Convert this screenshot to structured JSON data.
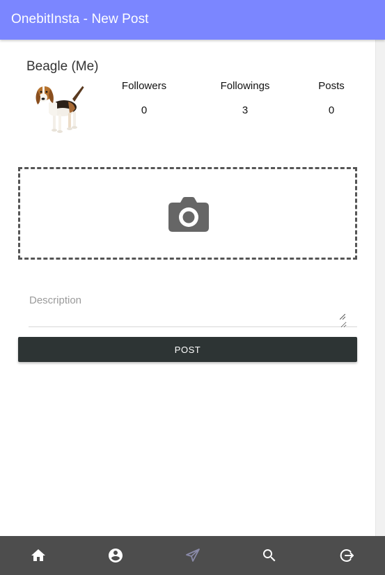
{
  "app_bar": {
    "title": "OnebitInsta - New Post",
    "background_color": "#7b86ff"
  },
  "profile": {
    "name": "Beagle (Me)",
    "avatar_description": "beagle dog photo",
    "stats": [
      {
        "label": "Followers",
        "value": "0"
      },
      {
        "label": "Followings",
        "value": "3"
      },
      {
        "label": "Posts",
        "value": "0"
      }
    ]
  },
  "upload": {
    "icon": "camera-icon"
  },
  "form": {
    "description_placeholder": "Description",
    "description_value": "",
    "submit_label": "POST",
    "submit_color": "#2d3434"
  },
  "bottom_nav": {
    "background_color": "#4d4d4d",
    "items": [
      {
        "icon": "home-icon"
      },
      {
        "icon": "account-icon"
      },
      {
        "icon": "send-icon",
        "active": true
      },
      {
        "icon": "search-icon"
      },
      {
        "icon": "logout-icon"
      }
    ]
  }
}
